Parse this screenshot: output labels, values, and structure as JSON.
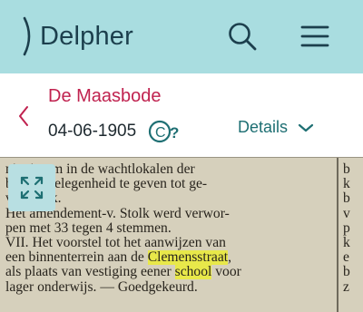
{
  "header": {
    "logo_text": "Delpher",
    "search_icon": "search-icon",
    "menu_icon": "hamburger-menu-icon"
  },
  "info_bar": {
    "title": "De Maasbode",
    "date": "04-06-1905",
    "copyright_badge": "C?",
    "details_label": "Details"
  },
  "scan": {
    "lines": [
      {
        "parts": [
          {
            "t": "niet in om in de wachtlokalen der"
          }
        ]
      },
      {
        "parts": [
          {
            "t": "booten gelegenheid te geven tot ge-"
          }
        ]
      },
      {
        "parts": [
          {
            "t": "van melk."
          }
        ]
      },
      {
        "parts": [
          {
            "t": "Het amendement-v. Stolk werd verwor-"
          }
        ]
      },
      {
        "parts": [
          {
            "t": "pen met 33 tegen 4 stemmen."
          }
        ]
      },
      {
        "parts": [
          {
            "t": "VII. Het voorstel tot het aanwijzen van"
          }
        ]
      },
      {
        "parts": [
          {
            "t": "een binnenterrein aan de "
          },
          {
            "t": "Clemensstraat",
            "hl": true
          },
          {
            "t": ","
          }
        ]
      },
      {
        "parts": [
          {
            "t": "als plaats van vestiging eener "
          },
          {
            "t": "school",
            "hl": true
          },
          {
            "t": " voor"
          }
        ]
      },
      {
        "parts": [
          {
            "t": "lager onderwijs. — Goedgekeurd."
          }
        ]
      }
    ],
    "right_column": [
      "b",
      "k",
      "b",
      "v",
      "p",
      "k",
      "e",
      "b",
      "z"
    ]
  },
  "colors": {
    "header_bg": "#a9dde0",
    "brand_dark": "#1c3f4d",
    "title_accent": "#c0224f",
    "link_teal": "#1e6f73",
    "highlight": "#e8e84a"
  }
}
